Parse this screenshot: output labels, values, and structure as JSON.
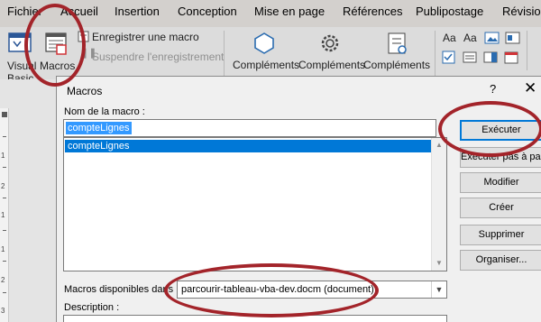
{
  "tabs": [
    "Fichier",
    "Accueil",
    "Insertion",
    "Conception",
    "Mise en page",
    "Références",
    "Publipostage",
    "Révision"
  ],
  "ribbon": {
    "visual_basic_line1": "Visual",
    "visual_basic_line2": "Basic",
    "macros_label": "Macros",
    "record_macro": "Enregistrer une macro",
    "pause_recording": "Suspendre l'enregistrement",
    "addins_1": "Compléments",
    "addins_2": "Compléments",
    "addins_3": "Compléments",
    "aa_1": "Aa",
    "aa_2": "Aa"
  },
  "ruler": {
    "marks": [
      "1",
      "2",
      "1",
      "1",
      "2",
      "3"
    ]
  },
  "dialog": {
    "title": "Macros",
    "help": "?",
    "close": "✕",
    "name_label": "Nom de la macro :",
    "name_value": "compteLignes",
    "list_items": [
      "compteLignes"
    ],
    "available_label": "Macros disponibles dans :",
    "available_value": "parcourir-tableau-vba-dev.docm (document)",
    "description_label": "Description :",
    "buttons": {
      "run": "Exécuter",
      "step_into": "Exécuter pas à pas",
      "edit": "Modifier",
      "create": "Créer",
      "delete": "Supprimer",
      "organizer": "Organiser..."
    }
  },
  "colors": {
    "annotation": "#a3242a",
    "selection": "#0078d7"
  }
}
